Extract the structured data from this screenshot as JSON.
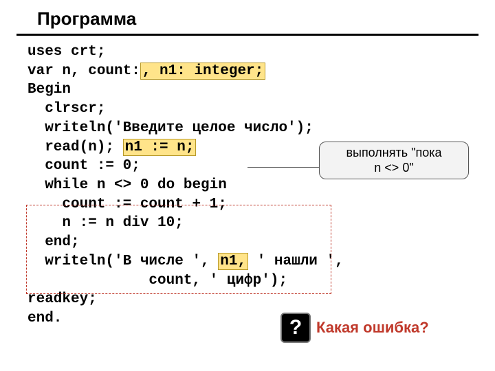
{
  "title": "Программа",
  "code": {
    "l1": "uses crt;",
    "l2a": "var n, count:",
    "l2_h": ", n1: integer;",
    "l3": "Begin",
    "l4": "  clrscr;",
    "l5": "  writeln('Введите целое число');",
    "l6a": "  read(n); ",
    "l6_h": "n1 := n;",
    "l7": "  count := 0;",
    "l8": "  while n <> 0 do begin",
    "l9": "    count := count + 1;",
    "l10": "    n := n div 10;",
    "l11": "  end;",
    "l12a": "  writeln('В числе ',",
    "l12_h": "n1,",
    "l12b": "' нашли ',",
    "l13": "              count, ' цифр');",
    "l14": "readkey;",
    "l15": "end."
  },
  "callout": {
    "line1": "выполнять \"пока",
    "line2": "n <> 0\""
  },
  "question": {
    "badge": "?",
    "text": "Какая ошибка?"
  }
}
